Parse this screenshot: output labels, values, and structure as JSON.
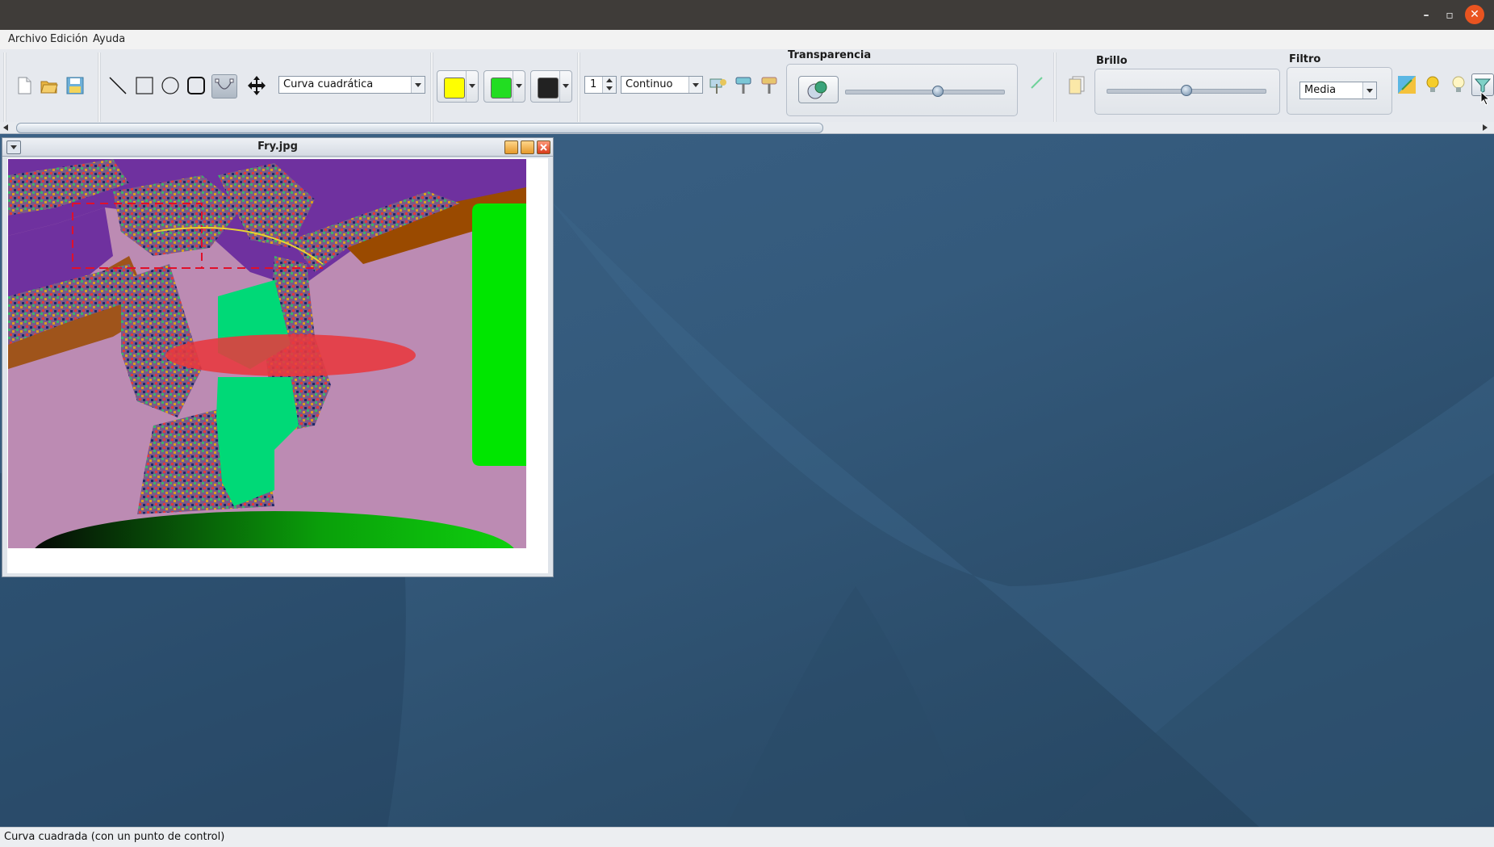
{
  "window": {
    "controls": [
      "minimize-icon",
      "maximize-icon",
      "close-icon"
    ]
  },
  "menu": {
    "items": [
      "Archivo",
      "Edición",
      "Ayuda"
    ]
  },
  "toolbar": {
    "shape_combo": "Curva cuadrática",
    "colors": {
      "fill": "#ffff00",
      "border": "#22dd22",
      "third": "#222222"
    },
    "stroke_width": "1",
    "stroke_style": "Continuo",
    "transparency": {
      "label": "Transparencia",
      "level": 0.58
    },
    "brightness": {
      "label": "Brillo",
      "level": 0.5
    },
    "filter": {
      "label": "Filtro",
      "value": "Media"
    }
  },
  "internal_window": {
    "title": "Fry.jpg"
  },
  "status": {
    "text": "Curva cuadrada (con un punto de control)"
  },
  "theme": {
    "titlebar": "#3f3c39",
    "close_accent": "#e95420",
    "desktop": "#345a7c"
  }
}
